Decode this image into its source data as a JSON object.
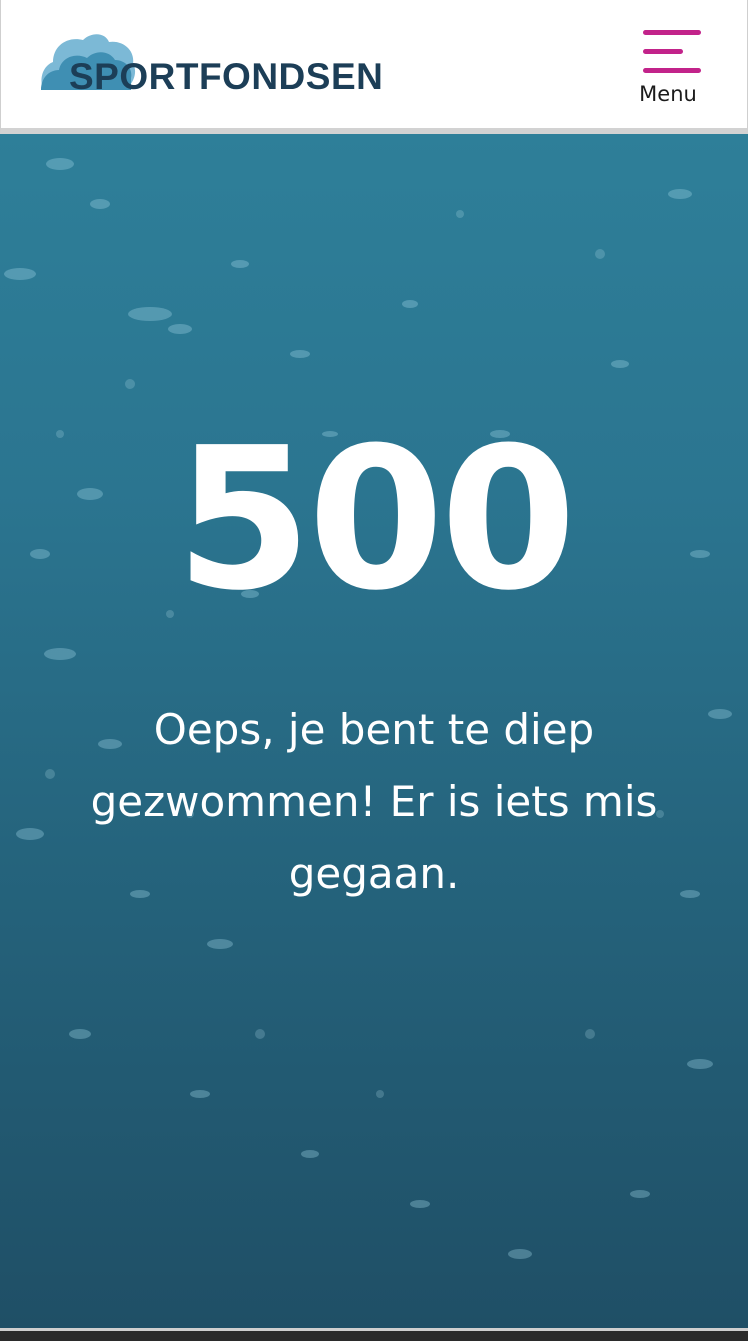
{
  "header": {
    "logo_text": "SPORTFONDSEN",
    "logo_icon": "cloud-logo-icon",
    "menu_label": "Menu",
    "menu_icon": "hamburger-menu-icon"
  },
  "error": {
    "code": "500",
    "message": "Oeps, je bent te diep gezwommen! Er is iets mis gegaan."
  },
  "colors": {
    "brand_navy": "#1c3e57",
    "logo_cloud_light": "#7cb9d6",
    "logo_cloud_mid": "#3f8fb3",
    "menu_accent": "#c2238a",
    "hero_top": "#2e7f99",
    "hero_bottom": "#1f4f66"
  }
}
